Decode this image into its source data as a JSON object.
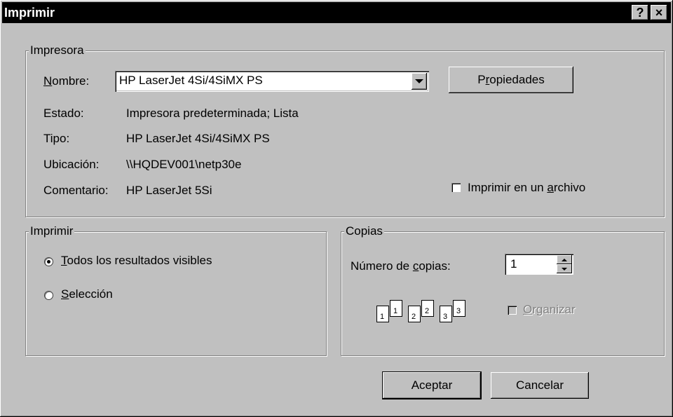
{
  "window": {
    "title": "Imprimir",
    "help_label": "?",
    "close_label": "×"
  },
  "printer": {
    "group_label": "Impresora",
    "name_label_pre": "",
    "name_label_ul": "N",
    "name_label_post": "ombre:",
    "name_value": "HP LaserJet 4Si/4SiMX PS",
    "properties_pre": "P",
    "properties_ul": "r",
    "properties_post": "opiedades",
    "status_label": "Estado:",
    "status_value": "Impresora predeterminada; Lista",
    "type_label": "Tipo:",
    "type_value": "HP LaserJet 4Si/4SiMX PS",
    "location_label": "Ubicación:",
    "location_value": "\\\\HQDEV001\\netp30e",
    "comment_label": "Comentario:",
    "comment_value": "HP LaserJet 5Si",
    "print_to_file_pre": "Imprimir en un ",
    "print_to_file_ul": "a",
    "print_to_file_post": "rchivo",
    "print_to_file_checked": false
  },
  "print_range": {
    "group_label": "Imprimir",
    "option_all_ul": "T",
    "option_all_post": "odos los resultados visibles",
    "option_all_selected": true,
    "option_selection_ul": "S",
    "option_selection_post": "elección",
    "option_selection_selected": false
  },
  "copies": {
    "group_label": "Copias",
    "count_label_pre": "Número de ",
    "count_label_ul": "c",
    "count_label_post": "opias:",
    "count_value": "1",
    "collate_ul": "O",
    "collate_post": "rganizar",
    "collate_checked": false,
    "collate_enabled": false,
    "page_numbers": [
      "1",
      "1",
      "2",
      "2",
      "3",
      "3"
    ]
  },
  "buttons": {
    "ok_label": "Aceptar",
    "cancel_label": "Cancelar"
  }
}
